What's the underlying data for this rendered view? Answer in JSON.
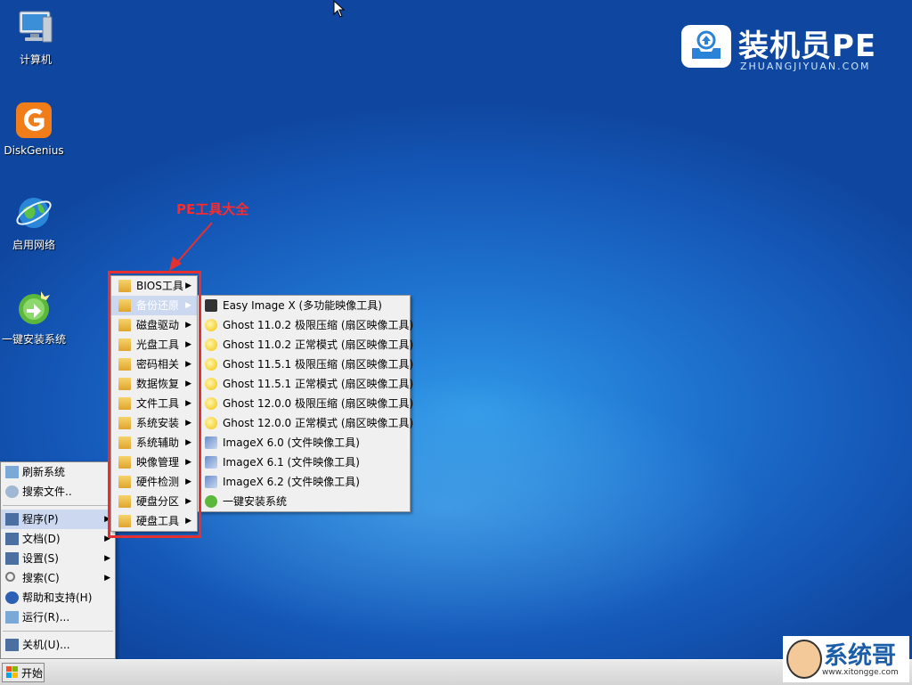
{
  "desktop": {
    "icons": [
      {
        "label": "计算机",
        "icon": "computer-icon"
      },
      {
        "label": "DiskGenius",
        "icon": "diskgenius-icon"
      },
      {
        "label": "启用网络",
        "icon": "network-globe-icon"
      },
      {
        "label": "一键安装系统",
        "icon": "install-system-icon"
      }
    ]
  },
  "logo": {
    "title": "装机员PE",
    "subtitle": "ZHUANGJIYUAN.COM"
  },
  "annotation": {
    "label": "PE工具大全",
    "color": "#e63030"
  },
  "programs_menu": {
    "items": [
      {
        "label": "BIOS工具",
        "has_submenu": true
      },
      {
        "label": "备份还原",
        "has_submenu": true,
        "active": true
      },
      {
        "label": "磁盘驱动",
        "has_submenu": true
      },
      {
        "label": "光盘工具",
        "has_submenu": true
      },
      {
        "label": "密码相关",
        "has_submenu": true
      },
      {
        "label": "数据恢复",
        "has_submenu": true
      },
      {
        "label": "文件工具",
        "has_submenu": true
      },
      {
        "label": "系统安装",
        "has_submenu": true
      },
      {
        "label": "系统辅助",
        "has_submenu": true
      },
      {
        "label": "映像管理",
        "has_submenu": true
      },
      {
        "label": "硬件检测",
        "has_submenu": true
      },
      {
        "label": "硬盘分区",
        "has_submenu": true
      },
      {
        "label": "硬盘工具",
        "has_submenu": true
      }
    ]
  },
  "backup_submenu": {
    "items": [
      {
        "label": "Easy Image X (多功能映像工具)",
        "icon": "easy-image-icon"
      },
      {
        "label": "Ghost 11.0.2 极限压缩 (扇区映像工具)",
        "icon": "ghost-icon"
      },
      {
        "label": "Ghost 11.0.2 正常模式 (扇区映像工具)",
        "icon": "ghost-icon"
      },
      {
        "label": "Ghost 11.5.1 极限压缩 (扇区映像工具)",
        "icon": "ghost-icon"
      },
      {
        "label": "Ghost 11.5.1 正常模式 (扇区映像工具)",
        "icon": "ghost-icon"
      },
      {
        "label": "Ghost 12.0.0 极限压缩 (扇区映像工具)",
        "icon": "ghost-icon"
      },
      {
        "label": "Ghost 12.0.0 正常模式 (扇区映像工具)",
        "icon": "ghost-icon"
      },
      {
        "label": "ImageX 6.0 (文件映像工具)",
        "icon": "imagex-icon"
      },
      {
        "label": "ImageX 6.1 (文件映像工具)",
        "icon": "imagex-icon"
      },
      {
        "label": "ImageX 6.2 (文件映像工具)",
        "icon": "imagex-icon"
      },
      {
        "label": "一键安装系统",
        "icon": "install-system-icon"
      }
    ]
  },
  "start_menu": {
    "top_items": [
      {
        "label": "刷新系统",
        "icon": "refresh-icon"
      },
      {
        "label": "搜索文件..",
        "icon": "search-file-icon"
      }
    ],
    "main_items": [
      {
        "label": "程序(P)",
        "icon": "programs-icon",
        "has_submenu": true,
        "active": true
      },
      {
        "label": "文档(D)",
        "icon": "documents-icon",
        "has_submenu": true
      },
      {
        "label": "设置(S)",
        "icon": "settings-icon",
        "has_submenu": true
      },
      {
        "label": "搜索(C)",
        "icon": "search-icon",
        "has_submenu": true
      },
      {
        "label": "帮助和支持(H)",
        "icon": "help-icon"
      },
      {
        "label": "运行(R)...",
        "icon": "run-icon"
      }
    ],
    "shutdown": {
      "label": "关机(U)...",
      "icon": "shutdown-icon"
    }
  },
  "taskbar": {
    "start_label": "开始"
  },
  "watermark": {
    "brand": "系统哥",
    "url": "www.xitongge.com"
  },
  "colors": {
    "desktop": "#1f74d0",
    "menu_bg": "#f0f0f0",
    "menu_active": "#cbd8ef",
    "annotation": "#e63030"
  }
}
